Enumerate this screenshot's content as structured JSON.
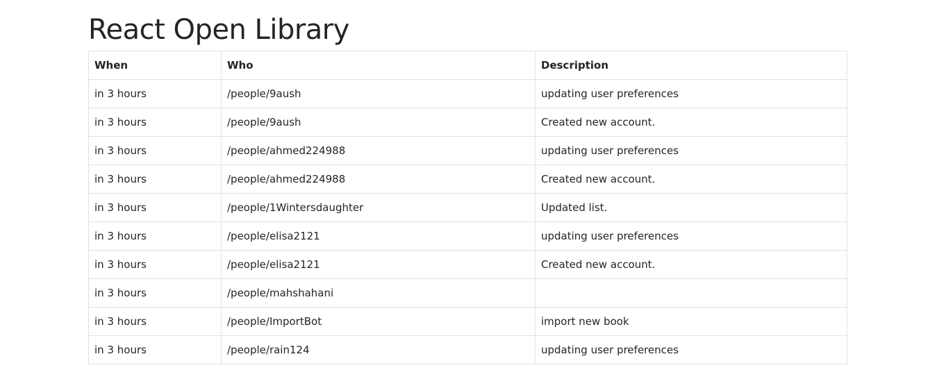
{
  "page": {
    "title": "React Open Library"
  },
  "table": {
    "headers": {
      "when": "When",
      "who": "Who",
      "description": "Description"
    },
    "rows": [
      {
        "when": "in 3 hours",
        "who": "/people/9aush",
        "description": "updating user preferences"
      },
      {
        "when": "in 3 hours",
        "who": "/people/9aush",
        "description": "Created new account."
      },
      {
        "when": "in 3 hours",
        "who": "/people/ahmed224988",
        "description": "updating user preferences"
      },
      {
        "when": "in 3 hours",
        "who": "/people/ahmed224988",
        "description": "Created new account."
      },
      {
        "when": "in 3 hours",
        "who": "/people/1Wintersdaughter",
        "description": "Updated list."
      },
      {
        "when": "in 3 hours",
        "who": "/people/elisa2121",
        "description": "updating user preferences"
      },
      {
        "when": "in 3 hours",
        "who": "/people/elisa2121",
        "description": "Created new account."
      },
      {
        "when": "in 3 hours",
        "who": "/people/mahshahani",
        "description": ""
      },
      {
        "when": "in 3 hours",
        "who": "/people/ImportBot",
        "description": "import new book"
      },
      {
        "when": "in 3 hours",
        "who": "/people/rain124",
        "description": "updating user preferences"
      }
    ]
  }
}
